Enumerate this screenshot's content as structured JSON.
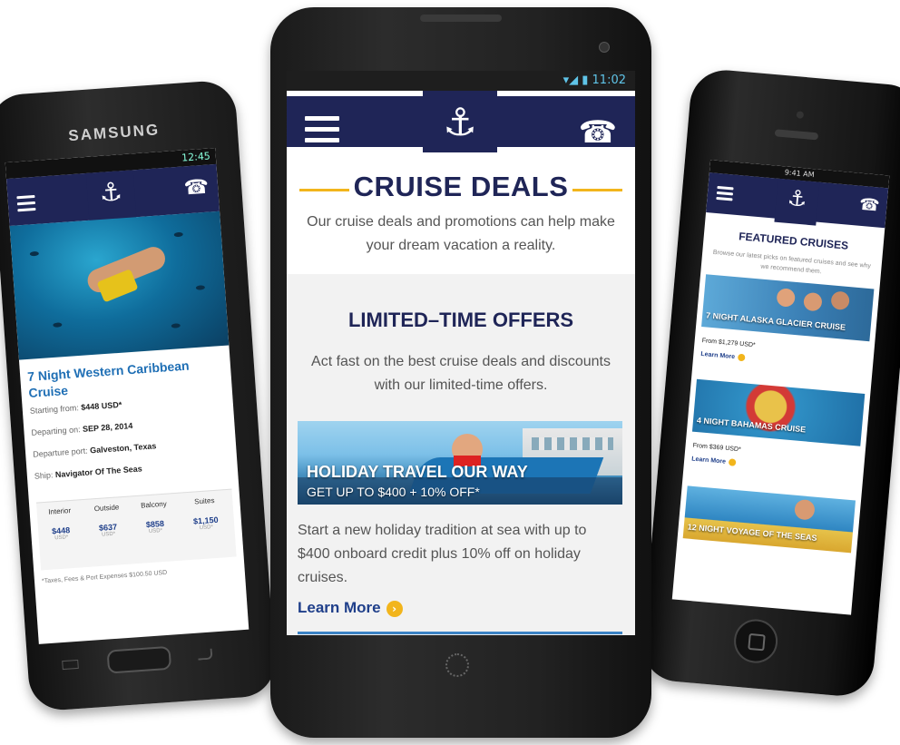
{
  "center": {
    "status_time": "11:02",
    "deals_title": "CRUISE DEALS",
    "deals_subtitle": "Our cruise deals and promotions can help make your dream vacation a reality.",
    "offers_title": "LIMITED–TIME OFFERS",
    "offers_subtitle": "Act fast on the best cruise deals and discounts with our limited-time offers.",
    "banner_title": "HOLIDAY TRAVEL OUR WAY",
    "banner_subtitle": "GET UP TO $400 + 10% OFF*",
    "promo_text": "Start a new holiday tradition at sea with up to $400 onboard credit plus 10% off on holiday cruises.",
    "learn_more": "Learn More"
  },
  "left": {
    "brand": "SAMSUNG",
    "status_time": "12:45",
    "cruise_title": "7 Night Western Caribbean Cruise",
    "starting_label": "Starting from:",
    "starting_value": "$448 USD*",
    "departing_label": "Departing on:",
    "departing_value": "SEP 28, 2014",
    "port_label": "Departure port:",
    "port_value": "Galveston, Texas",
    "ship_label": "Ship:",
    "ship_value": "Navigator Of The Seas",
    "prices": [
      {
        "label": "Interior",
        "value": "$448",
        "unit": "USD*"
      },
      {
        "label": "Outside",
        "value": "$637",
        "unit": "USD*"
      },
      {
        "label": "Balcony",
        "value": "$858",
        "unit": "USD*"
      },
      {
        "label": "Suites",
        "value": "$1,150",
        "unit": "USD*"
      }
    ],
    "note": "*Taxes, Fees & Port Expenses $100.50 USD"
  },
  "right": {
    "status_time": "9:41 AM",
    "featured_title": "FEATURED CRUISES",
    "featured_subtitle": "Browse our latest picks on featured cruises and see why we recommend them.",
    "items": [
      {
        "caption": "7 NIGHT ALASKA GLACIER CRUISE",
        "price": "From $1,279 USD*",
        "learn": "Learn More"
      },
      {
        "caption": "4 NIGHT BAHAMAS CRUISE",
        "price": "From $369 USD*",
        "learn": "Learn More"
      },
      {
        "caption": "12 NIGHT VOYAGE OF THE SEAS",
        "price": "",
        "learn": ""
      }
    ]
  },
  "colors": {
    "navy": "#1f2557",
    "gold": "#f2b51c",
    "link": "#1f3f8a"
  },
  "icons": {
    "menu": "hamburger-icon",
    "logo": "crown-anchor-logo",
    "call": "phone-icon",
    "arrow": "circle-arrow-icon"
  }
}
